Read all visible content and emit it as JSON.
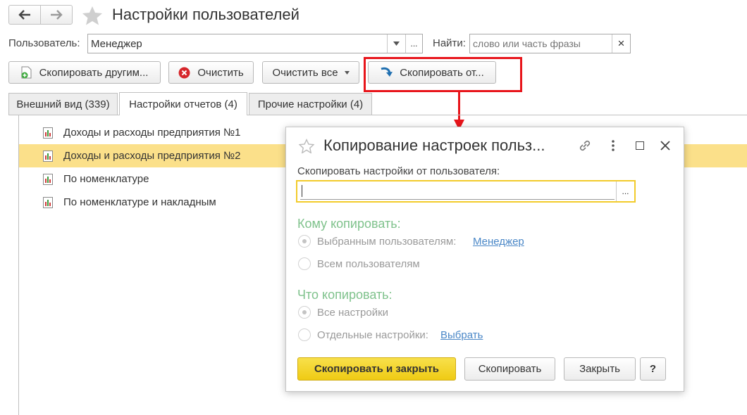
{
  "window": {
    "title": "Настройки пользователей"
  },
  "filter": {
    "user_label": "Пользователь:",
    "user_value": "Менеджер",
    "select_btn": "...",
    "find_label": "Найти:",
    "find_placeholder": "слово или часть фразы",
    "clear_glyph": "×"
  },
  "toolbar": {
    "copy_others": "Скопировать другим...",
    "clear": "Очистить",
    "clear_all": "Очистить все",
    "copy_from": "Скопировать от..."
  },
  "tabs": [
    {
      "label": "Внешний вид (339)"
    },
    {
      "label": "Настройки отчетов (4)"
    },
    {
      "label": "Прочие настройки (4)"
    }
  ],
  "reports": [
    {
      "label": "Доходы и расходы предприятия  №1"
    },
    {
      "label": "Доходы и расходы предприятия  №2"
    },
    {
      "label": "По номенклатуре"
    },
    {
      "label": "По номенклатуре и накладным"
    }
  ],
  "dialog": {
    "title": "Копирование настроек польз...",
    "from_label": "Скопировать настройки от пользователя:",
    "from_value": "",
    "from_btn": "...",
    "to_heading": "Кому копировать:",
    "to_selected": "Выбранным пользователям:",
    "to_selected_link": "Менеджер",
    "to_all": "Всем пользователям",
    "what_heading": "Что копировать:",
    "what_all": "Все настройки",
    "what_some": "Отдельные настройки:",
    "what_some_link": "Выбрать",
    "btn_copy_close": "Скопировать и закрыть",
    "btn_copy": "Скопировать",
    "btn_close": "Закрыть",
    "btn_help": "?"
  },
  "colors": {
    "highlight_row": "#fbe08a",
    "primary_button": "#f4d62a",
    "annotation_red": "#e8151b",
    "section_heading": "#7fc28c",
    "link": "#4a87c7"
  }
}
